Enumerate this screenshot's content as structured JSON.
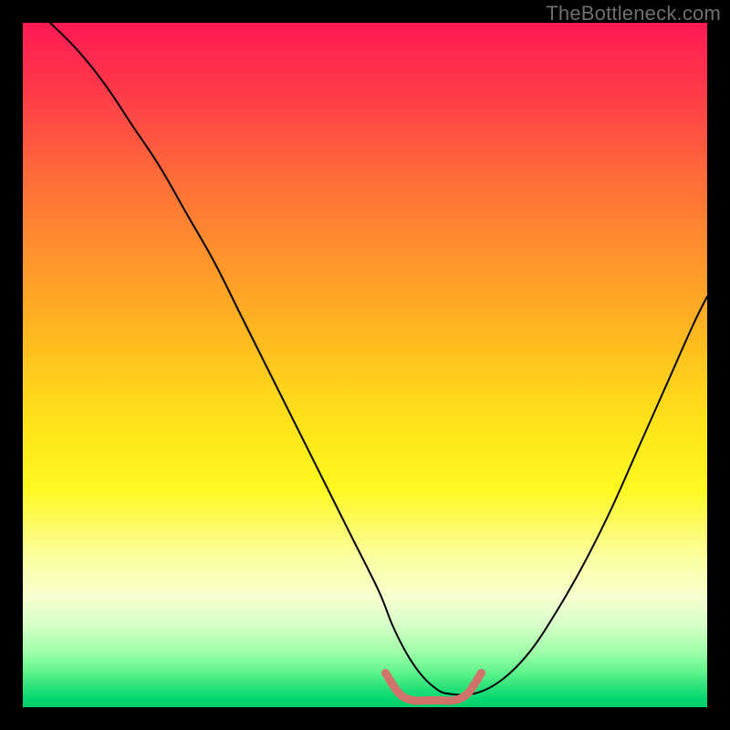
{
  "watermark": "TheBottleneck.com",
  "chart_data": {
    "type": "line",
    "title": "",
    "xlabel": "",
    "ylabel": "",
    "xlim": [
      0,
      100
    ],
    "ylim": [
      0,
      100
    ],
    "legend": false,
    "grid": false,
    "background_gradient": {
      "direction": "vertical",
      "stops": [
        {
          "pos": 0,
          "color": "#ff1a54"
        },
        {
          "pos": 22,
          "color": "#ff6a3a"
        },
        {
          "pos": 58,
          "color": "#ffe21a"
        },
        {
          "pos": 84,
          "color": "#f6ffd0"
        },
        {
          "pos": 100,
          "color": "#00cf6c"
        }
      ]
    },
    "series": [
      {
        "name": "main-curve",
        "color": "#000000",
        "stroke_width": 2,
        "x": [
          4,
          8,
          12,
          16,
          20,
          24,
          28,
          32,
          36,
          40,
          44,
          48,
          52,
          54,
          56,
          58,
          60,
          62,
          66,
          70,
          74,
          78,
          82,
          86,
          90,
          94,
          98,
          100
        ],
        "y": [
          100,
          96,
          91,
          85,
          79,
          72,
          65,
          57,
          49,
          41,
          33,
          25,
          17,
          12,
          8,
          5,
          3,
          2,
          2,
          4,
          8,
          14,
          21,
          29,
          38,
          47,
          56,
          60
        ]
      },
      {
        "name": "bottom-band",
        "color": "#d2736b",
        "stroke_width": 9,
        "x": [
          53,
          55,
          57,
          59,
          61,
          63,
          65,
          67
        ],
        "y": [
          5,
          2,
          1,
          1,
          1,
          1,
          2,
          5
        ]
      }
    ]
  }
}
